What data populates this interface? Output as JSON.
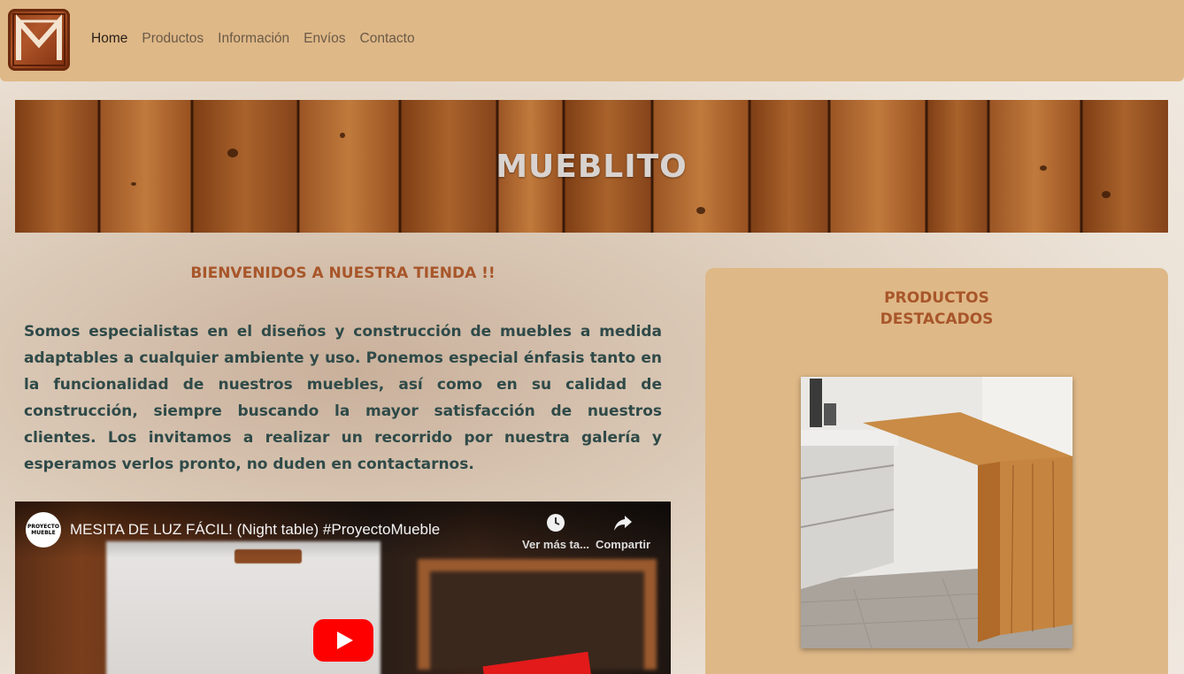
{
  "nav": {
    "logo_alt": "M",
    "links": [
      "Home",
      "Productos",
      "Información",
      "Envíos",
      "Contacto"
    ],
    "active": "Home"
  },
  "banner": {
    "title": "MUEBLITO"
  },
  "main": {
    "welcome": "BIENVENIDOS A NUESTRA TIENDA !!",
    "intro": "Somos especialistas en el diseños y construcción de muebles a medida adaptables a cualquier ambiente y uso. Ponemos especial énfasis tanto en la funcionalidad de nuestros muebles, así como en su calidad de construcción, siempre buscando la mayor satisfacción de nuestros clientes. Los invitamos a realizar un recorrido por nuestra galería y esperamos verlos pronto, no duden en contactarnos."
  },
  "video": {
    "title": "MESITA DE LUZ FÁCIL! (Night table) #ProyectoMueble",
    "channel": "PROYECTO MUEBLE",
    "watch_later": "Ver más ta...",
    "share": "Compartir"
  },
  "featured": {
    "title_line1": "PRODUCTOS",
    "title_line2": "DESTACADOS"
  },
  "colors": {
    "nav_bg": "#dfb887",
    "accent": "#a8562a",
    "text": "#2f4a48",
    "youtube_red": "#ff0000"
  }
}
